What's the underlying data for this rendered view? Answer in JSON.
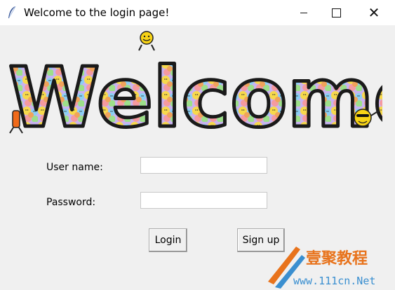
{
  "window": {
    "title": "Welcome to the login page!"
  },
  "banner": {
    "text": "Welcome"
  },
  "form": {
    "username_label": "User name:",
    "username_value": "",
    "password_label": "Password:",
    "password_value": ""
  },
  "buttons": {
    "login": "Login",
    "signup": "Sign up"
  },
  "watermark": {
    "cn_text": "壹聚教程",
    "url": "www.111cn.Net"
  },
  "icons": {
    "app_icon": "feather-icon",
    "minimize": "minimize-icon",
    "maximize": "maximize-icon",
    "close": "close-icon"
  },
  "colors": {
    "titlebar_bg": "#ffffff",
    "window_bg": "#f0f0f0",
    "watermark_orange": "#e8731c",
    "watermark_blue": "#3a8fd0"
  }
}
